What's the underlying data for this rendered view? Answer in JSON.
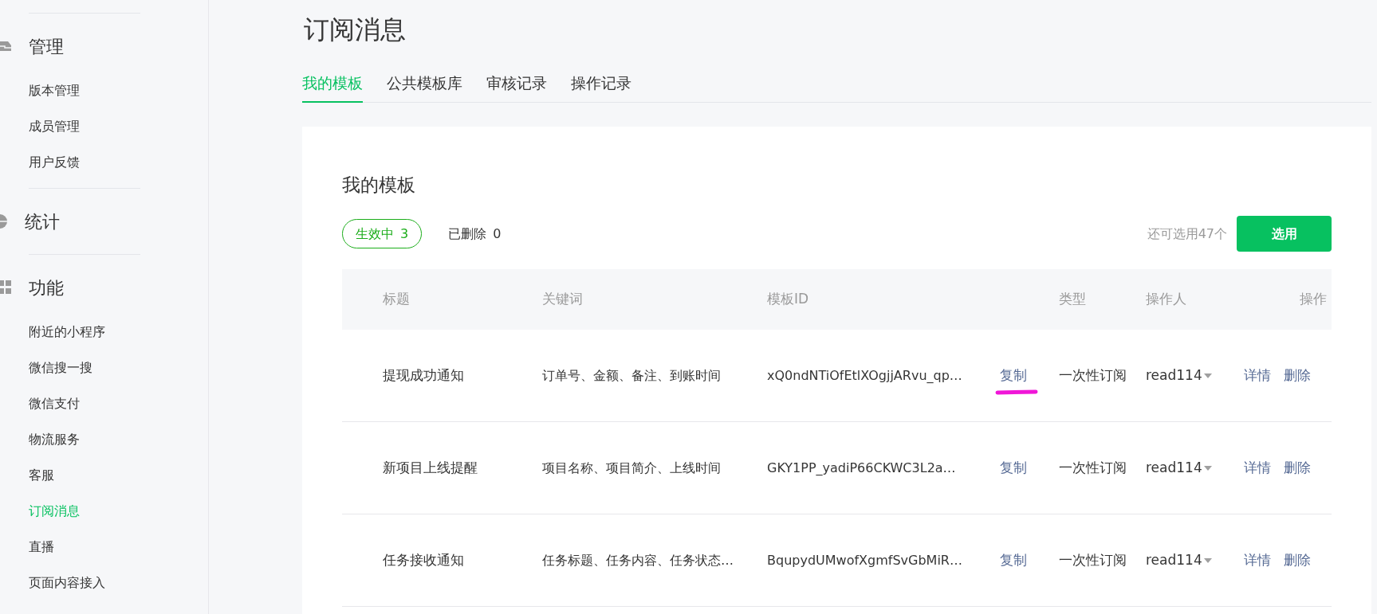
{
  "sidebar": {
    "groups": [
      {
        "kind": "inbox",
        "title": "管理",
        "items": [
          {
            "label": "版本管理",
            "selected": false
          },
          {
            "label": "成员管理",
            "selected": false
          },
          {
            "label": "用户反馈",
            "selected": false
          }
        ]
      },
      {
        "kind": "pie",
        "title": "统计"
      },
      {
        "kind": "grid",
        "title": "功能",
        "items": [
          {
            "label": "附近的小程序",
            "selected": false
          },
          {
            "label": "微信搜一搜",
            "selected": false
          },
          {
            "label": "微信支付",
            "selected": false
          },
          {
            "label": "物流服务",
            "selected": false
          },
          {
            "label": "客服",
            "selected": false
          },
          {
            "label": "订阅消息",
            "selected": true
          },
          {
            "label": "直播",
            "selected": false
          },
          {
            "label": "页面内容接入",
            "selected": false
          }
        ]
      }
    ]
  },
  "page_title": "订阅消息",
  "tabs": [
    {
      "label": "我的模板",
      "selected": true
    },
    {
      "label": "公共模板库",
      "selected": false
    },
    {
      "label": "审核记录",
      "selected": false
    },
    {
      "label": "操作记录",
      "selected": false
    }
  ],
  "card": {
    "title": "我的模板",
    "filters": [
      {
        "label": "生效中",
        "count": "3",
        "selected": true
      },
      {
        "label": "已删除",
        "count": "0",
        "selected": false
      }
    ],
    "remaining": "还可选用47个",
    "select_button": "选用",
    "columns": [
      "标题",
      "关键词",
      "模板ID",
      "类型",
      "操作人",
      "操作"
    ],
    "rows": [
      {
        "title": "提现成功通知",
        "keywords": "订单号、金额、备注、到账时间",
        "template_id": "xQ0ndNTiOfEtlXOgjjARvu_qp…",
        "copy": "复制",
        "type": "一次性订阅",
        "operator": "read114",
        "details": "详情",
        "delete": "删除",
        "marked": true
      },
      {
        "title": "新项目上线提醒",
        "keywords": "项目名称、项目简介、上线时间",
        "template_id": "GKY1PP_yadiP66CKWC3L2a…",
        "copy": "复制",
        "type": "一次性订阅",
        "operator": "read114",
        "details": "详情",
        "delete": "删除",
        "marked": false
      },
      {
        "title": "任务接收通知",
        "keywords": "任务标题、任务内容、任务状态…",
        "template_id": "BqupydUMwofXgmfSvGbMiR…",
        "copy": "复制",
        "type": "一次性订阅",
        "operator": "read114",
        "details": "详情",
        "delete": "删除",
        "marked": false
      }
    ]
  }
}
